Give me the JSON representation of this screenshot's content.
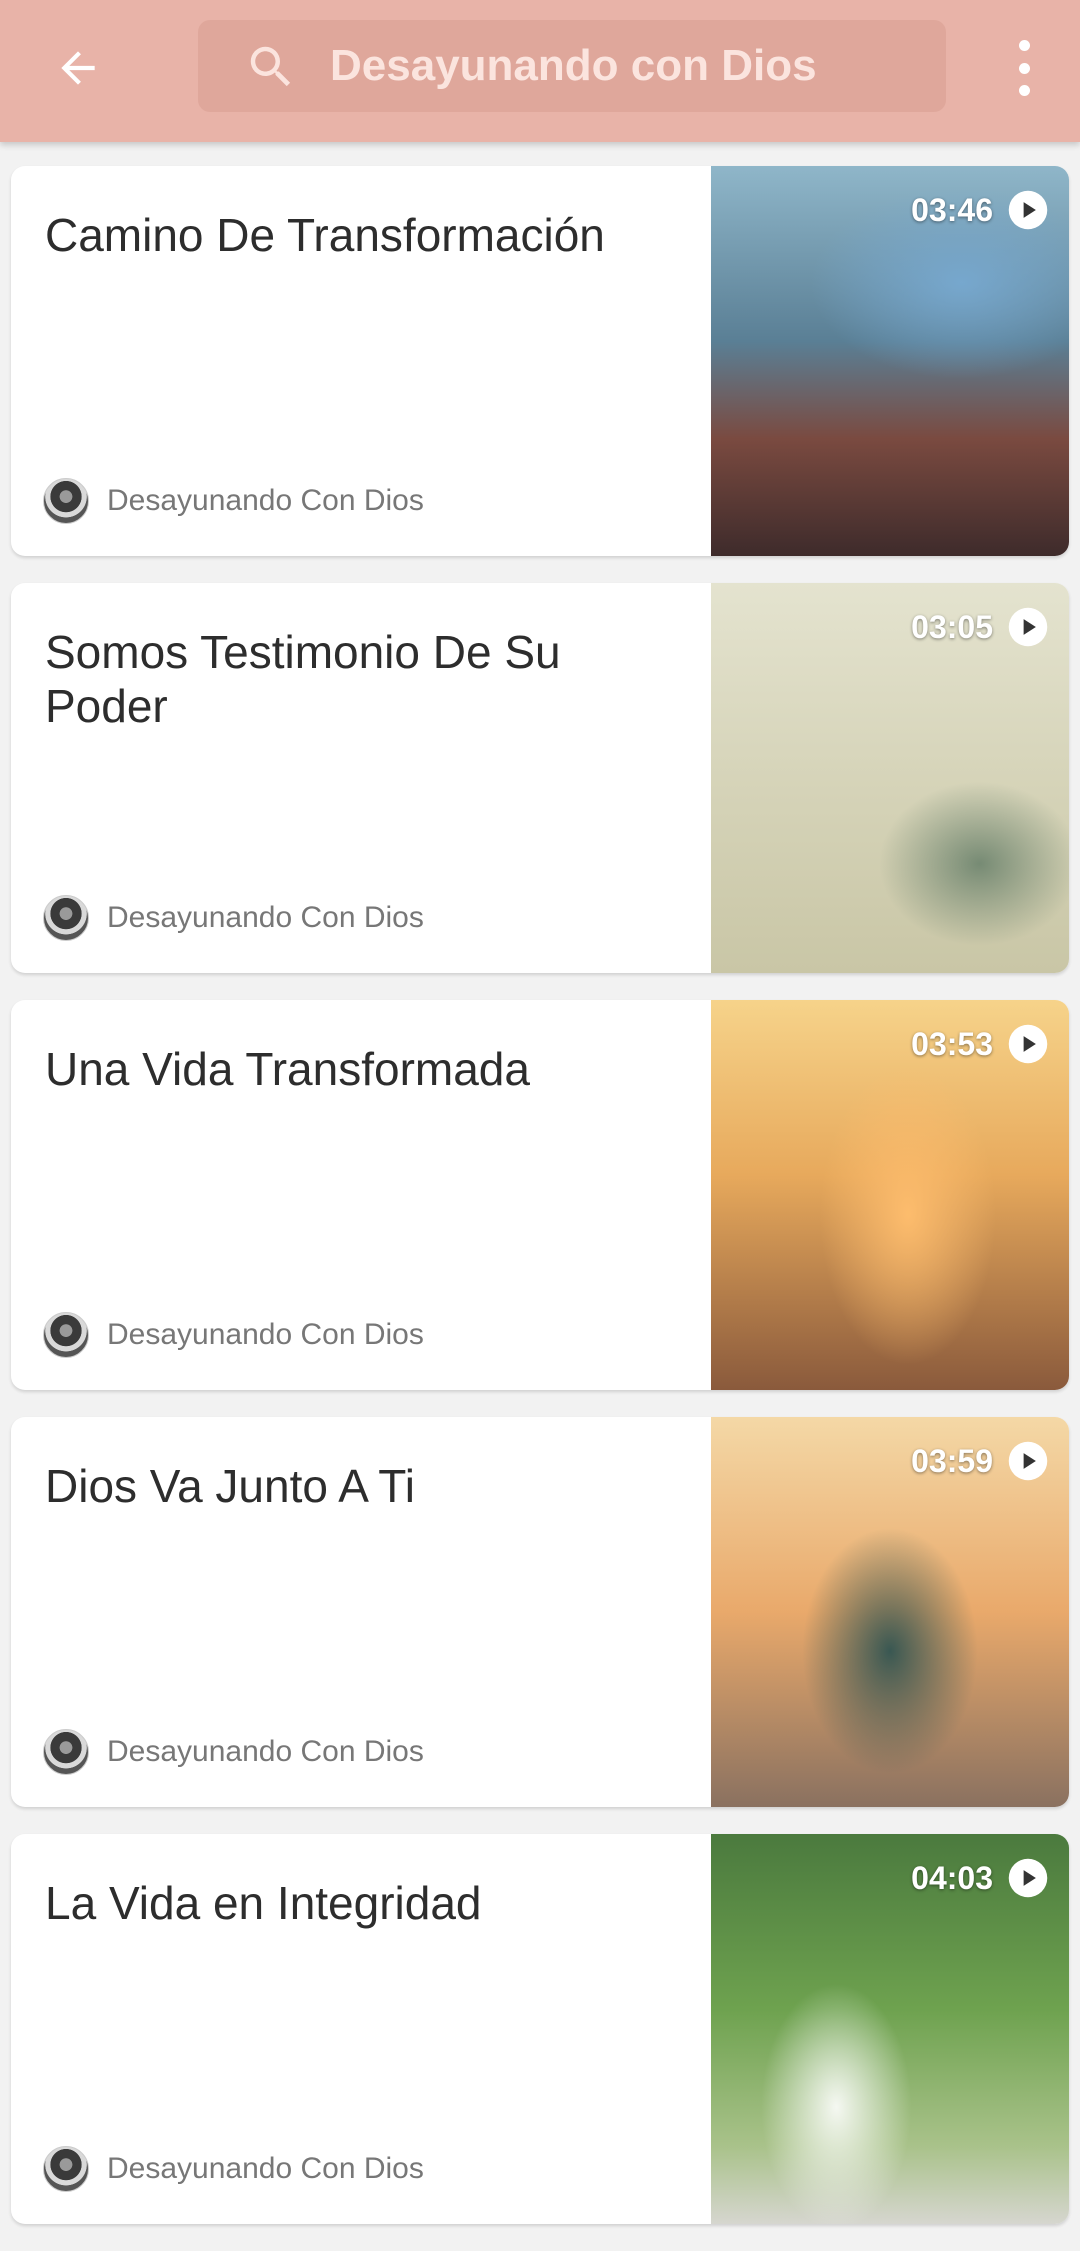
{
  "search": {
    "query": "Desayunando con Dios"
  },
  "icons": {
    "back": "arrow-back-icon",
    "search": "search-icon",
    "more": "more-vert-icon",
    "play": "play-circle-icon"
  },
  "colors": {
    "appbar": "#e8b3a8",
    "searchbox": "#dfa79b"
  },
  "videos": [
    {
      "title": "Camino De Transformación",
      "channel": "Desayunando Con Dios",
      "duration": "03:46"
    },
    {
      "title": "Somos Testimonio De Su Poder",
      "channel": "Desayunando Con Dios",
      "duration": "03:05"
    },
    {
      "title": "Una Vida Transformada",
      "channel": "Desayunando Con Dios",
      "duration": "03:53"
    },
    {
      "title": "Dios Va Junto A Ti",
      "channel": "Desayunando Con Dios",
      "duration": "03:59"
    },
    {
      "title": "La Vida en Integridad",
      "channel": "Desayunando Con Dios",
      "duration": "04:03"
    }
  ]
}
